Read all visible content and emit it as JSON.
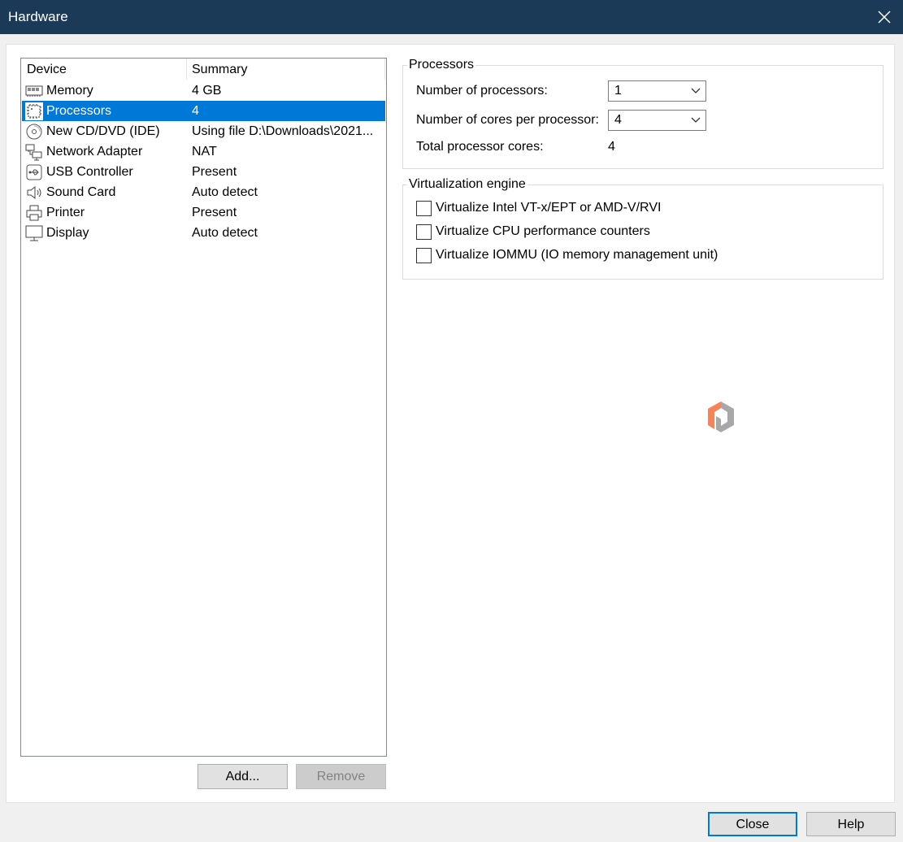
{
  "window": {
    "title": "Hardware"
  },
  "device_list": {
    "columns": {
      "device": "Device",
      "summary": "Summary"
    },
    "rows": [
      {
        "icon": "memory-icon",
        "name": "Memory",
        "summary": "4 GB",
        "selected": false
      },
      {
        "icon": "processor-icon",
        "name": "Processors",
        "summary": "4",
        "selected": true
      },
      {
        "icon": "cd-dvd-icon",
        "name": "New CD/DVD (IDE)",
        "summary": "Using file D:\\Downloads\\2021...",
        "selected": false
      },
      {
        "icon": "network-adapter-icon",
        "name": "Network Adapter",
        "summary": "NAT",
        "selected": false
      },
      {
        "icon": "usb-icon",
        "name": "USB Controller",
        "summary": "Present",
        "selected": false
      },
      {
        "icon": "speaker-icon",
        "name": "Sound Card",
        "summary": "Auto detect",
        "selected": false
      },
      {
        "icon": "printer-icon",
        "name": "Printer",
        "summary": "Present",
        "selected": false
      },
      {
        "icon": "display-icon",
        "name": "Display",
        "summary": "Auto detect",
        "selected": false
      }
    ],
    "add_label": "Add...",
    "remove_label": "Remove"
  },
  "processors_group": {
    "title": "Processors",
    "num_processors_label": "Number of processors:",
    "num_processors_value": "1",
    "cores_label": "Number of cores per processor:",
    "cores_value": "4",
    "total_label": "Total processor cores:",
    "total_value": "4"
  },
  "virtualization_group": {
    "title": "Virtualization engine",
    "options": [
      {
        "label": "Virtualize Intel VT-x/EPT or AMD-V/RVI",
        "checked": false
      },
      {
        "label": "Virtualize CPU performance counters",
        "checked": false
      },
      {
        "label": "Virtualize IOMMU (IO memory management unit)",
        "checked": false
      }
    ]
  },
  "footer": {
    "close_label": "Close",
    "help_label": "Help"
  },
  "colors": {
    "titlebar": "#1b3a57",
    "selection": "#0078d7",
    "logo_orange": "#f5845c",
    "logo_gray": "#a8a8a8"
  }
}
